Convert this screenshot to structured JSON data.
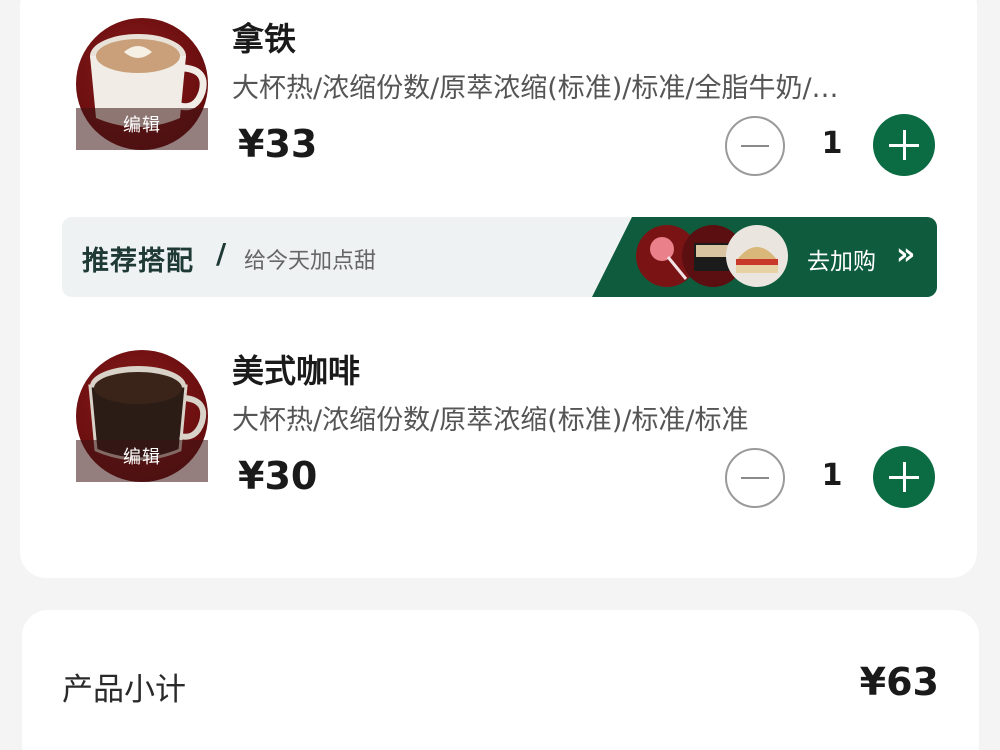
{
  "cart": {
    "items": [
      {
        "name": "拿铁",
        "spec": "大杯热/浓缩份数/原萃浓缩(标准)/标准/全脂牛奶/…",
        "price": "¥33",
        "quantity": "1",
        "edit_label": "编辑",
        "image_icon": "latte-cup-icon"
      },
      {
        "name": "美式咖啡",
        "spec": "大杯热/浓缩份数/原萃浓缩(标准)/标准/标准",
        "price": "¥30",
        "quantity": "1",
        "edit_label": "编辑",
        "image_icon": "americano-cup-icon"
      }
    ],
    "recommendation": {
      "title": "推荐搭配",
      "separator": "/",
      "subtitle": "给今天加点甜",
      "cta_label": "去加购",
      "cta_icon": "double-chevron-right-icon",
      "product_icons": [
        "lollipop-icon",
        "cake-box-icon",
        "sandwich-icon"
      ]
    }
  },
  "summary": {
    "subtotal_label": "产品小计",
    "subtotal_value": "¥63"
  },
  "colors": {
    "accent_green": "#0b6b43",
    "reco_green": "#0e5b3d",
    "image_bg": "#6d0f10"
  }
}
